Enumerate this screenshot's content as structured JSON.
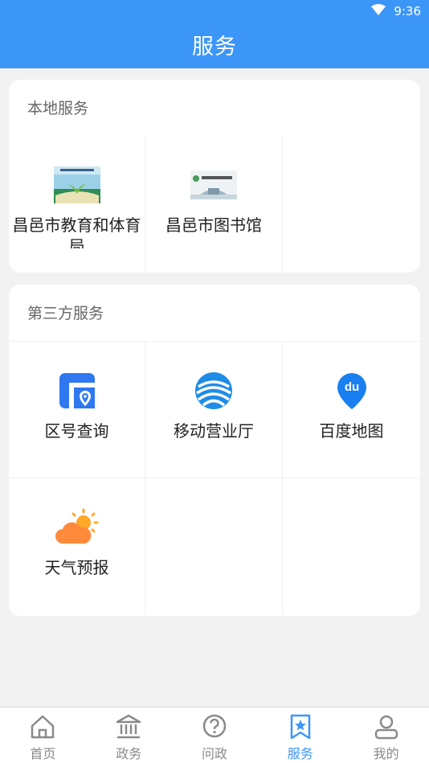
{
  "status_bar": {
    "time": "9:36"
  },
  "header": {
    "title": "服务"
  },
  "local_services": {
    "title": "本地服务",
    "items": [
      {
        "label": "昌邑市教育和体育局",
        "icon": "education-bureau-logo"
      },
      {
        "label": "昌邑市图书馆",
        "icon": "library-logo"
      }
    ]
  },
  "third_party_services": {
    "title": "第三方服务",
    "items": [
      {
        "label": "区号查询",
        "icon": "area-code-icon"
      },
      {
        "label": "移动营业厅",
        "icon": "china-mobile-icon"
      },
      {
        "label": "百度地图",
        "icon": "baidu-map-icon"
      },
      {
        "label": "天气预报",
        "icon": "weather-icon"
      }
    ]
  },
  "tabbar": {
    "items": [
      {
        "label": "首页",
        "icon": "home-icon",
        "active": false
      },
      {
        "label": "政务",
        "icon": "government-icon",
        "active": false
      },
      {
        "label": "问政",
        "icon": "question-icon",
        "active": false
      },
      {
        "label": "服务",
        "icon": "service-star-icon",
        "active": true
      },
      {
        "label": "我的",
        "icon": "user-icon",
        "active": false
      }
    ]
  },
  "colors": {
    "primary": "#3c96f7",
    "background": "#f2f2f2",
    "inactive": "#8a8a8a"
  }
}
